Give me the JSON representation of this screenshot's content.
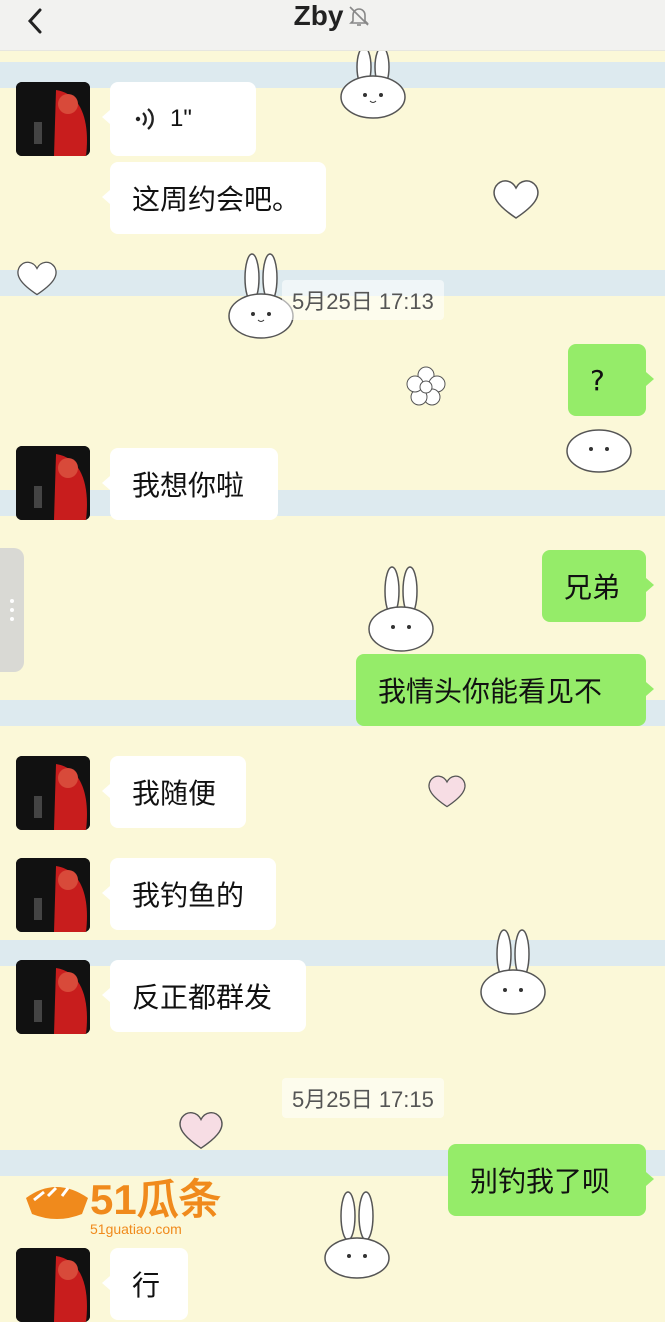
{
  "header": {
    "title": "Zby",
    "back_icon": "chevron-left-icon",
    "mute_icon": "bell-off-icon"
  },
  "messages": [
    {
      "side": "in",
      "type": "voice",
      "duration": "1\""
    },
    {
      "side": "in",
      "type": "text",
      "text": "这周约会吧。"
    },
    {
      "type": "timestamp",
      "text": "5月25日 17:13"
    },
    {
      "side": "out",
      "type": "text",
      "text": "?"
    },
    {
      "side": "in",
      "type": "text",
      "text": "我想你啦"
    },
    {
      "side": "out",
      "type": "text",
      "text": "兄弟"
    },
    {
      "side": "out",
      "type": "text",
      "text": "我情头你能看见不"
    },
    {
      "side": "in",
      "type": "text",
      "text": "我随便"
    },
    {
      "side": "in",
      "type": "text",
      "text": "我钓鱼的"
    },
    {
      "side": "in",
      "type": "text",
      "text": "反正都群发"
    },
    {
      "type": "timestamp",
      "text": "5月25日 17:15"
    },
    {
      "side": "out",
      "type": "text",
      "text": "别钓我了呗"
    },
    {
      "side": "in",
      "type": "text",
      "text": "行"
    }
  ],
  "watermark": {
    "name": "51瓜条",
    "site": "51guatiao.com"
  },
  "colors": {
    "out_bubble": "#95ec69",
    "in_bubble": "#ffffff",
    "background": "#fbf8d8",
    "stripe": "#d7e7f3"
  }
}
